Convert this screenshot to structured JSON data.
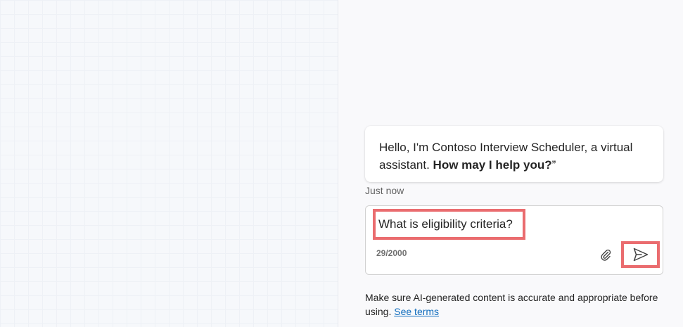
{
  "chat": {
    "bot_message": {
      "text_prefix": "Hello, I'm Contoso Interview Scheduler, a virtual assistant. ",
      "text_bold": "How may I help you?",
      "text_suffix": "”"
    },
    "timestamp": "Just now",
    "composer": {
      "input_value": "What is eligibility criteria?",
      "char_count": "29/2000",
      "attach_icon": "paperclip-icon",
      "send_icon": "send-icon"
    },
    "disclaimer": {
      "text": "Make sure AI-generated content is accurate and appropriate before using.",
      "link_label": "See terms"
    }
  },
  "colors": {
    "highlight": "#ea6c6f",
    "link": "#0f6cbd",
    "canvas_background": "#f6f8fb",
    "chat_background": "#f9f9fb"
  }
}
